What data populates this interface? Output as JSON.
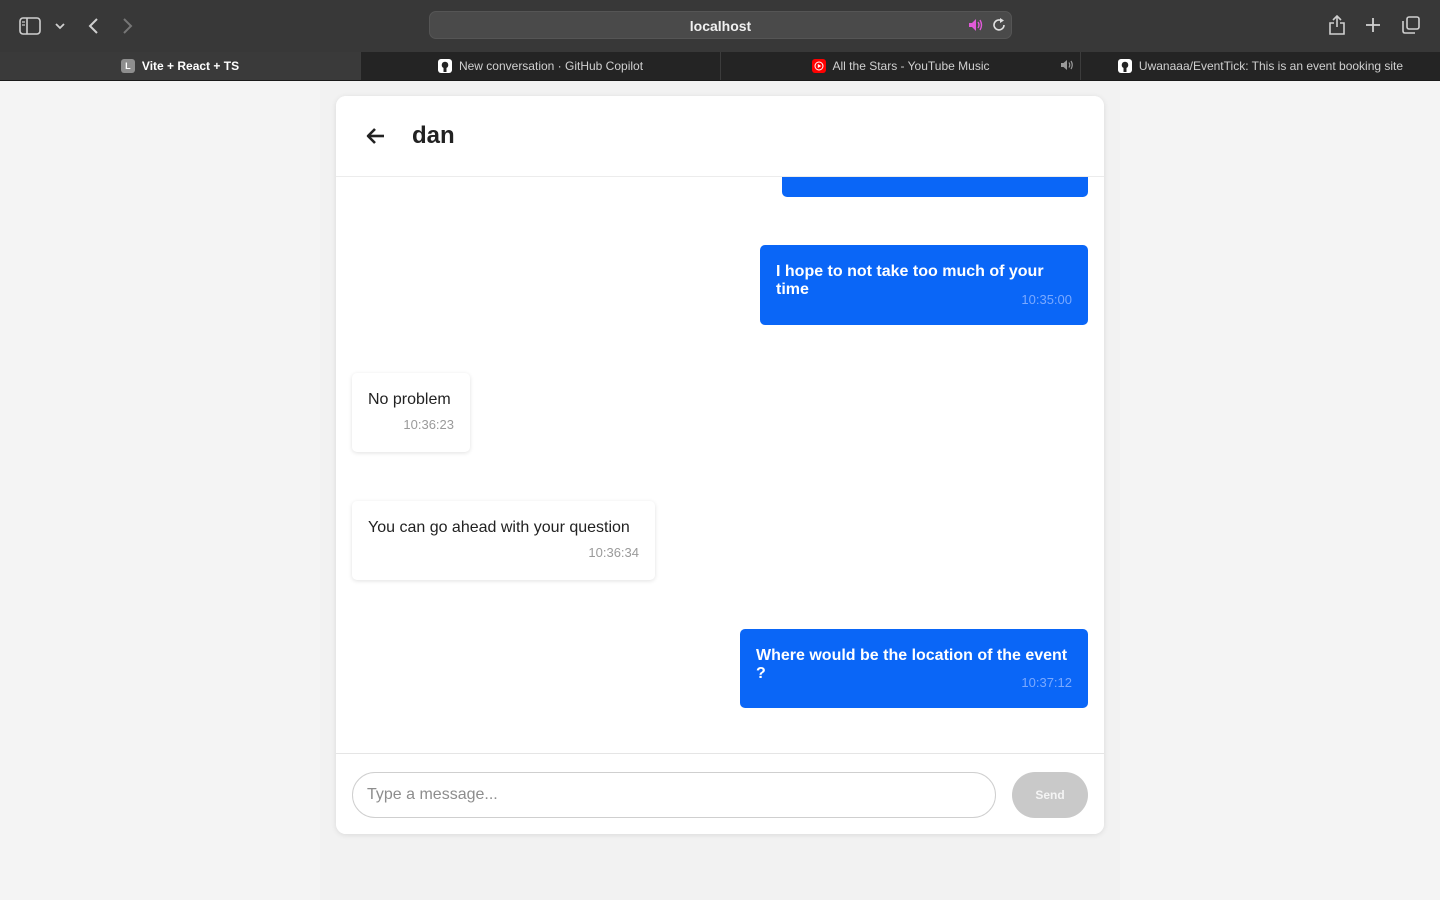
{
  "browser": {
    "address": "localhost",
    "tabs": [
      {
        "title": "Vite + React + TS",
        "favicon": "letter-L",
        "favicon_letter": "L",
        "active": true
      },
      {
        "title": "New conversation · GitHub Copilot",
        "favicon": "github-icon",
        "active": false
      },
      {
        "title": "All the Stars - YouTube Music",
        "favicon": "youtube-music-icon",
        "active": false,
        "playing_audio": true
      },
      {
        "title": "Uwanaaa/EventTick: This is an event booking site",
        "favicon": "github-icon",
        "active": false
      }
    ],
    "icons": [
      "sidebar-toggle-icon",
      "chevron-down-icon",
      "back-arrow-icon",
      "forward-arrow-icon",
      "speaker-icon",
      "reload-icon",
      "share-icon",
      "plus-icon",
      "tabs-overview-icon"
    ]
  },
  "chat": {
    "contact_name": "dan",
    "back_icon": "arrow-left-icon",
    "messages": [
      {
        "sender": "me",
        "text": "",
        "time": ""
      },
      {
        "sender": "me",
        "text": "I hope to not take too much of your time",
        "time": "10:35:00"
      },
      {
        "sender": "them",
        "text": "No problem",
        "time": "10:36:23"
      },
      {
        "sender": "them",
        "text": "You can go ahead with your question",
        "time": "10:36:34"
      },
      {
        "sender": "me",
        "text": "Where would be the location of the event ?",
        "time": "10:37:12"
      }
    ],
    "composer": {
      "placeholder": "Type a message...",
      "value": "",
      "send_label": "Send"
    }
  },
  "colors": {
    "outgoing_bubble": "#0a66f7",
    "incoming_bubble": "#ffffff",
    "send_button_disabled": "#c9c9c9"
  }
}
